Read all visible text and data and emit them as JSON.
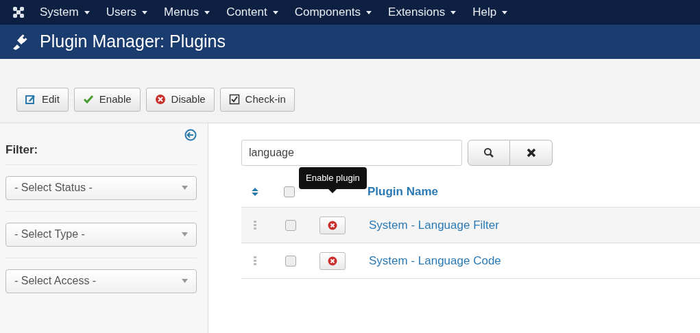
{
  "menu": [
    {
      "label": "System"
    },
    {
      "label": "Users"
    },
    {
      "label": "Menus"
    },
    {
      "label": "Content"
    },
    {
      "label": "Components"
    },
    {
      "label": "Extensions"
    },
    {
      "label": "Help"
    }
  ],
  "page_title": "Plugin Manager: Plugins",
  "toolbar": [
    {
      "kind": "edit",
      "label": "Edit"
    },
    {
      "kind": "enable",
      "label": "Enable"
    },
    {
      "kind": "disable",
      "label": "Disable"
    },
    {
      "kind": "checkin",
      "label": "Check-in"
    }
  ],
  "sidebar": {
    "heading": "Filter:",
    "filters": [
      {
        "placeholder": "- Select Status -"
      },
      {
        "placeholder": "- Select Type -"
      },
      {
        "placeholder": "- Select Access -"
      }
    ]
  },
  "search": {
    "value": "language"
  },
  "table": {
    "columns": [
      "Plugin Name"
    ],
    "select_all_checked": false,
    "rows": [
      {
        "checked": false,
        "enabled": false,
        "name": "System - Language Filter"
      },
      {
        "checked": false,
        "enabled": false,
        "name": "System - Language Code"
      }
    ]
  },
  "tooltip": "Enable plugin"
}
